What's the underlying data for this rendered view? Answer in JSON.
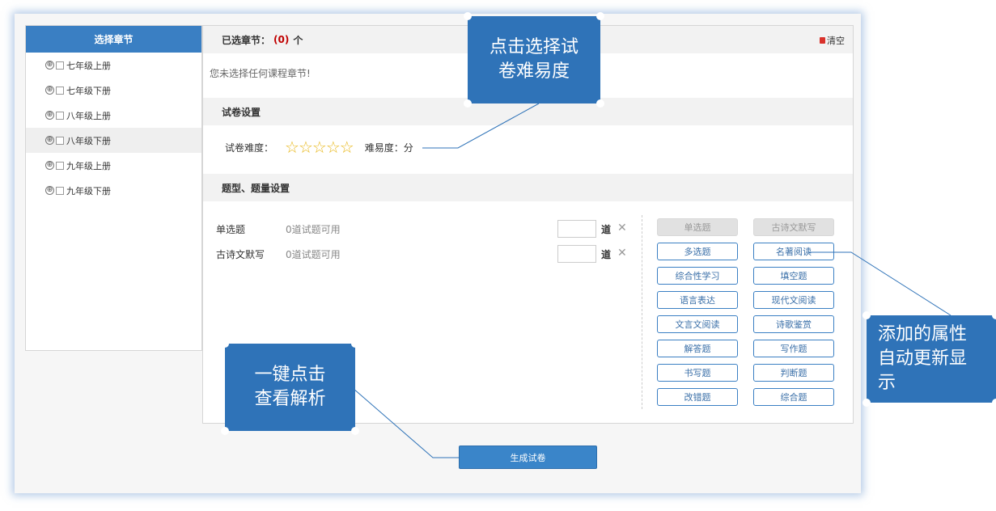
{
  "sidebar": {
    "title": "选择章节",
    "items": [
      {
        "label": "七年级上册"
      },
      {
        "label": "七年级下册"
      },
      {
        "label": "八年级上册"
      },
      {
        "label": "八年级下册"
      },
      {
        "label": "九年级上册"
      },
      {
        "label": "九年级下册"
      }
    ],
    "selected_index": 3,
    "plus_glyph": "⊕"
  },
  "selected": {
    "label": "已选章节：",
    "count": "(0)",
    "unit": "个",
    "clear_label": "清空",
    "empty_hint": "您未选择任何课程章节!"
  },
  "paper_settings": {
    "title": "试卷设置",
    "difficulty_label": "试卷难度：",
    "stars_total": 5,
    "stars_filled": 0,
    "ease_label": "难易度：分"
  },
  "question_settings": {
    "title": "题型、题量设置",
    "rows": [
      {
        "name": "单选题",
        "available": "0道试题可用",
        "value": "",
        "unit": "道"
      },
      {
        "name": "古诗文默写",
        "available": "0道试题可用",
        "value": "",
        "unit": "道"
      }
    ],
    "type_buttons": [
      {
        "label": "单选题",
        "disabled": true
      },
      {
        "label": "古诗文默写",
        "disabled": true
      },
      {
        "label": "多选题"
      },
      {
        "label": "名著阅读"
      },
      {
        "label": "综合性学习"
      },
      {
        "label": "填空题"
      },
      {
        "label": "语言表达"
      },
      {
        "label": "现代文阅读"
      },
      {
        "label": "文言文阅读"
      },
      {
        "label": "诗歌鉴赏"
      },
      {
        "label": "解答题"
      },
      {
        "label": "写作题"
      },
      {
        "label": "书写题"
      },
      {
        "label": "判断题"
      },
      {
        "label": "改错题"
      },
      {
        "label": "综合题"
      }
    ]
  },
  "generate_button": "生成试卷",
  "callouts": {
    "difficulty": [
      "点击选择试",
      "卷难易度"
    ],
    "attributes": [
      "添加的属性",
      "自动更新显",
      "示"
    ],
    "one_click": [
      "一键点击",
      "查看解析"
    ]
  },
  "colors": {
    "primary": "#3a7fc3",
    "callout": "#2f73b8",
    "star": "#e8b81c",
    "count": "#c00000"
  },
  "icons": {
    "star": "star-icon",
    "remove": "close-icon",
    "clear": "trash-icon",
    "tree_expand": "plus-circle-icon"
  }
}
